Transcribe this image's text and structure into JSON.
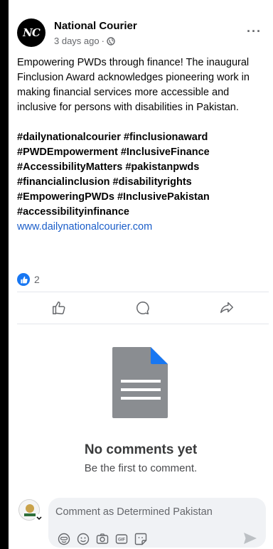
{
  "post": {
    "page_name": "National Courier",
    "avatar_text": "NC",
    "time": "3 days ago",
    "separator": "·",
    "body": "Empowering PWDs through finance! The inaugural Finclusion Award acknowledges pioneering work in making financial services more accessible and inclusive for persons with disabilities in Pakistan.",
    "hashtags": "#dailynationalcourier #finclusionaward #PWDEmpowerment #InclusiveFinance #AccessibilityMatters #pakistanpwds #financialinclusion #disabilityrights #EmpoweringPWDs #InclusivePakistan #accessibilityinfinance",
    "link": "www.dailynationalcourier.com",
    "more_label": "···"
  },
  "reactions": {
    "count": "2"
  },
  "actions": [
    {
      "icon": "like-icon"
    },
    {
      "icon": "comment-icon"
    },
    {
      "icon": "share-icon"
    }
  ],
  "empty_state": {
    "title": "No comments yet",
    "subtitle": "Be the first to comment."
  },
  "composer": {
    "placeholder": "Comment as Determined Pakistan",
    "tools": [
      "avatar-sticker-icon",
      "emoji-icon",
      "camera-icon",
      "gif-icon",
      "sticker-icon"
    ],
    "send_icon": "send-icon"
  },
  "colors": {
    "link": "#1b5ec9",
    "like_blue": "#1877f2",
    "doc_gray": "#8a8d91",
    "doc_corner": "#1877f2"
  }
}
